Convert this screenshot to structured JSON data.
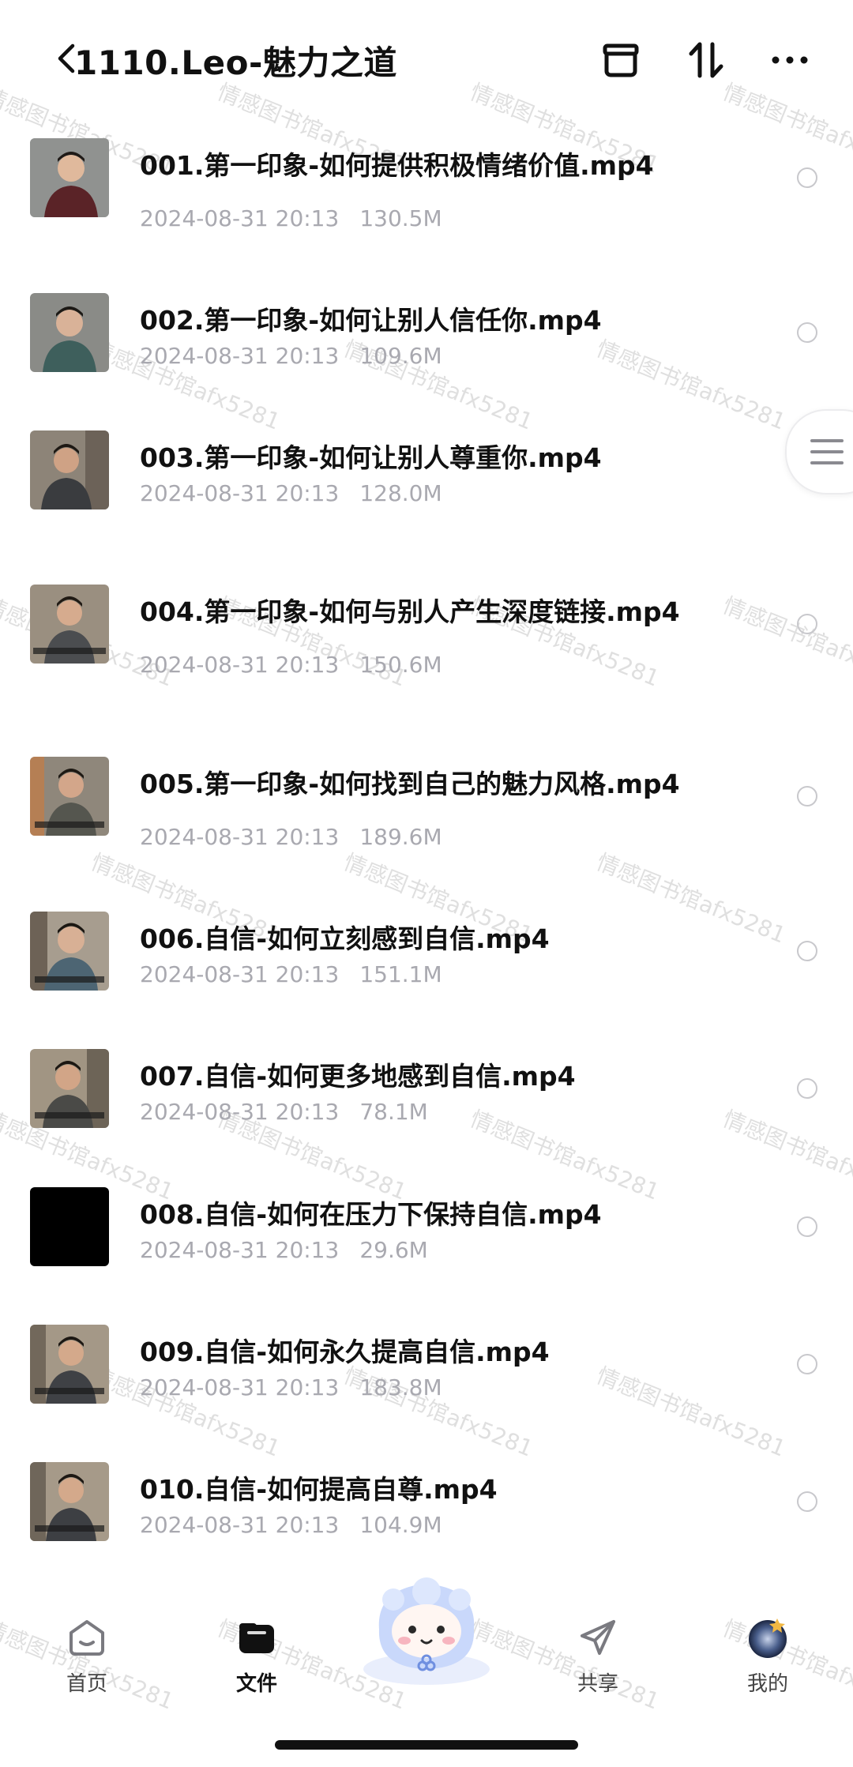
{
  "header": {
    "title": "1110.Leo-魅力之道",
    "icons": [
      "back-chevron-icon",
      "archive-box-icon",
      "sort-icon",
      "more-icon"
    ]
  },
  "watermark": "情感图书馆afx5281",
  "files": [
    {
      "name": "001.第一印象-如何提供积极情绪价值.mp4",
      "date": "2024-08-31 20:13",
      "size": "130.5M"
    },
    {
      "name": "002.第一印象-如何让别人信任你.mp4",
      "date": "2024-08-31 20:13",
      "size": "109.6M"
    },
    {
      "name": "003.第一印象-如何让别人尊重你.mp4",
      "date": "2024-08-31 20:13",
      "size": "128.0M"
    },
    {
      "name": "004.第一印象-如何与别人产生深度链接.mp4",
      "date": "2024-08-31 20:13",
      "size": "150.6M"
    },
    {
      "name": "005.第一印象-如何找到自己的魅力风格.mp4",
      "date": "2024-08-31 20:13",
      "size": "189.6M"
    },
    {
      "name": "006.自信-如何立刻感到自信.mp4",
      "date": "2024-08-31 20:13",
      "size": "151.1M"
    },
    {
      "name": "007.自信-如何更多地感到自信.mp4",
      "date": "2024-08-31 20:13",
      "size": "78.1M"
    },
    {
      "name": "008.自信-如何在压力下保持自信.mp4",
      "date": "2024-08-31 20:13",
      "size": "29.6M"
    },
    {
      "name": "009.自信-如何永久提高自信.mp4",
      "date": "2024-08-31 20:13",
      "size": "183.8M"
    },
    {
      "name": "010.自信-如何提高自尊.mp4",
      "date": "2024-08-31 20:13",
      "size": "104.9M"
    }
  ],
  "bottom_nav": {
    "home": "首页",
    "files": "文件",
    "share": "共享",
    "mine": "我的"
  },
  "colors": {
    "meta_text": "#a9a9b0",
    "title_text": "#111111",
    "thumb_bg": "#6f7479",
    "thumb_black": "#000000"
  }
}
